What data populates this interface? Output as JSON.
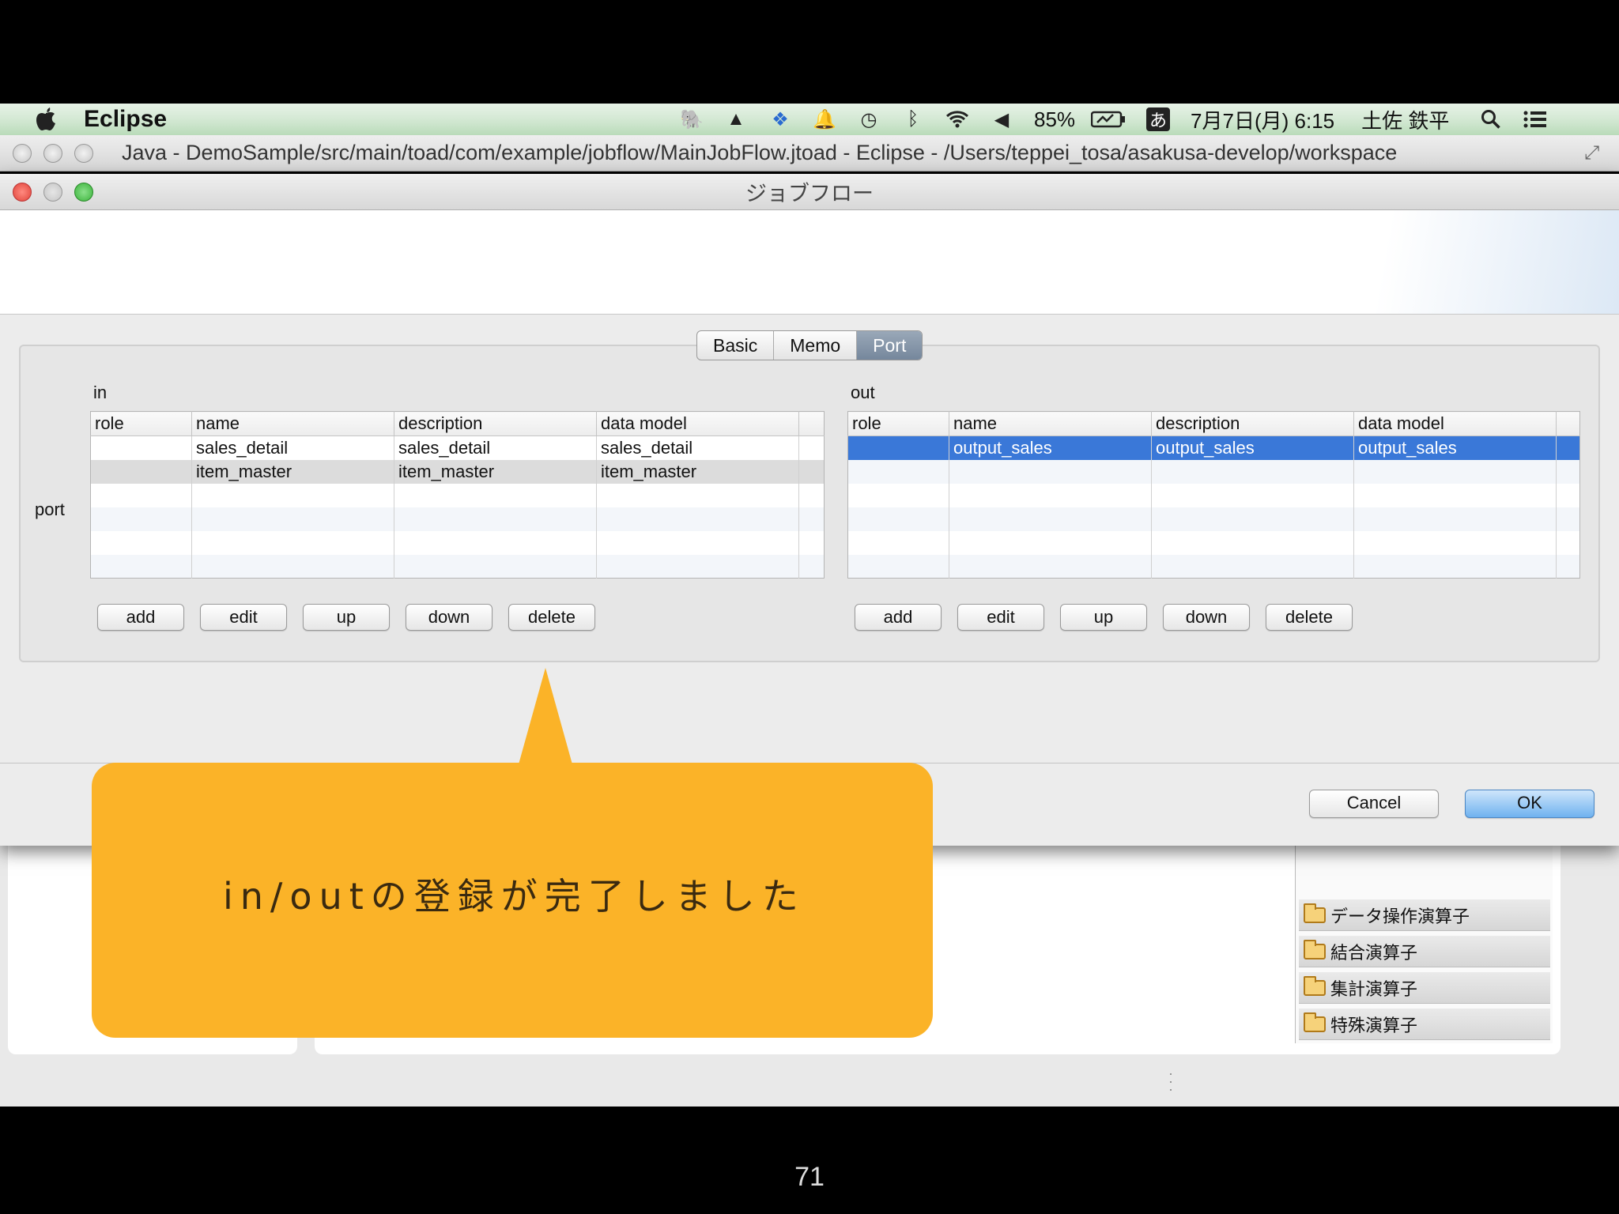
{
  "menubar": {
    "app_name": "Eclipse",
    "battery": "85%",
    "ime": "あ",
    "date_time": "7月7日(月) 6:15",
    "user": "土佐 鉄平"
  },
  "eclipse_window": {
    "title": "Java - DemoSample/src/main/toad/com/example/jobflow/MainJobFlow.jtoad - Eclipse - /Users/teppei_tosa/asakusa-develop/workspace"
  },
  "dialog": {
    "title": "ジョブフロー",
    "tabs": [
      "Basic",
      "Memo",
      "Port"
    ],
    "active_tab": "Port",
    "port_label": "port",
    "in": {
      "label": "in",
      "columns": [
        "role",
        "name",
        "description",
        "data model"
      ],
      "rows": [
        [
          "",
          "sales_detail",
          "sales_detail",
          "sales_detail"
        ],
        [
          "",
          "item_master",
          "item_master",
          "item_master"
        ]
      ],
      "buttons": [
        "add",
        "edit",
        "up",
        "down",
        "delete"
      ]
    },
    "out": {
      "label": "out",
      "columns": [
        "role",
        "name",
        "description",
        "data model"
      ],
      "rows": [
        [
          "",
          "output_sales",
          "output_sales",
          "output_sales"
        ]
      ],
      "buttons": [
        "add",
        "edit",
        "up",
        "down",
        "delete"
      ]
    },
    "cancel_label": "Cancel",
    "ok_label": "OK"
  },
  "palette": {
    "items": [
      "データ操作演算子",
      "結合演算子",
      "集計演算子",
      "特殊演算子"
    ]
  },
  "callout": {
    "text": "in/outの登録が完了しました",
    "color": "#fbb328"
  },
  "slide": {
    "page_number": "71"
  }
}
